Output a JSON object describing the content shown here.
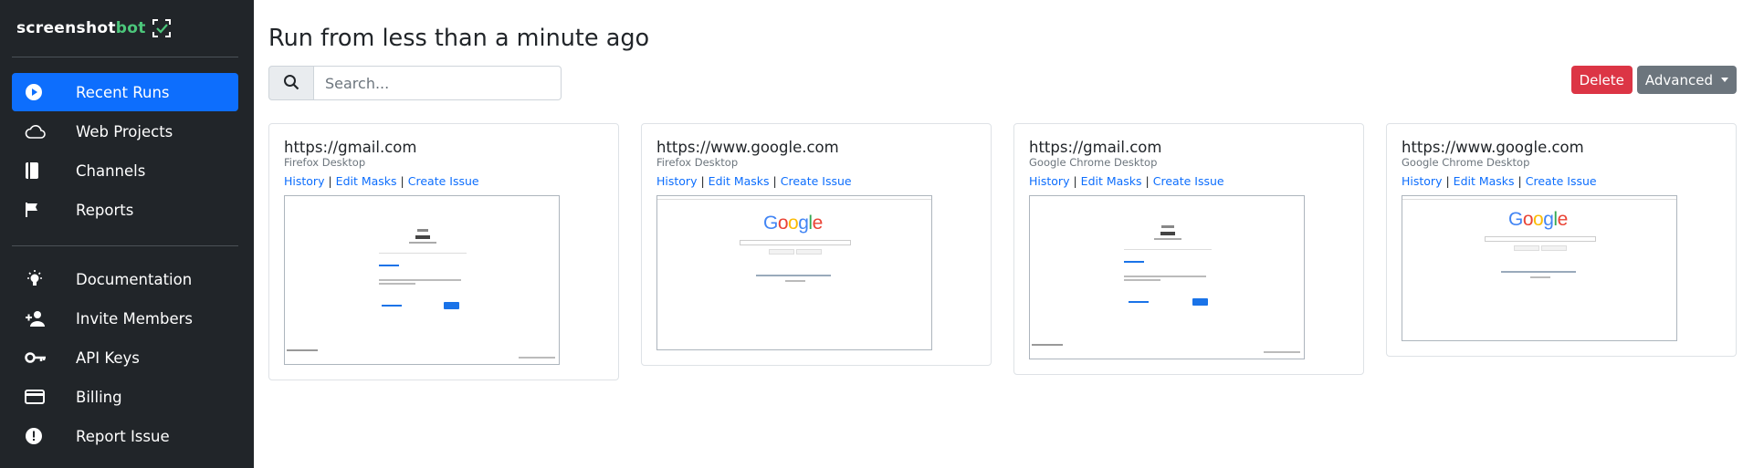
{
  "brand": {
    "name_part1": "screenshot",
    "name_part2": "bot"
  },
  "sidebar": {
    "primary": [
      {
        "label": "Recent Runs",
        "icon": "play-circle-icon",
        "active": true
      },
      {
        "label": "Web Projects",
        "icon": "cloud-icon"
      },
      {
        "label": "Channels",
        "icon": "book-icon"
      },
      {
        "label": "Reports",
        "icon": "flag-icon"
      }
    ],
    "secondary": [
      {
        "label": "Documentation",
        "icon": "lightbulb-icon"
      },
      {
        "label": "Invite Members",
        "icon": "person-add-icon"
      },
      {
        "label": "API Keys",
        "icon": "key-icon"
      },
      {
        "label": "Billing",
        "icon": "credit-card-icon"
      },
      {
        "label": "Report Issue",
        "icon": "exclamation-circle-icon"
      }
    ]
  },
  "page": {
    "title": "Run from less than a minute ago"
  },
  "search": {
    "placeholder": "Search...",
    "value": ""
  },
  "actions": {
    "delete_label": "Delete",
    "advanced_label": "Advanced"
  },
  "link_labels": {
    "history": "History",
    "edit_masks": "Edit Masks",
    "create_issue": "Create Issue",
    "separator": "|"
  },
  "cards": [
    {
      "url": "https://gmail.com",
      "browser": "Firefox Desktop",
      "thumbnail": "gmail-signin"
    },
    {
      "url": "https://www.google.com",
      "browser": "Firefox Desktop",
      "thumbnail": "google-home"
    },
    {
      "url": "https://gmail.com",
      "browser": "Google Chrome Desktop",
      "thumbnail": "gmail-signin"
    },
    {
      "url": "https://www.google.com",
      "browser": "Google Chrome Desktop",
      "thumbnail": "google-home"
    }
  ],
  "colors": {
    "sidebar_bg": "#212529",
    "active": "#0d6efd",
    "brand_accent": "#4cc77b",
    "danger": "#dc3545",
    "secondary": "#6c757d"
  }
}
